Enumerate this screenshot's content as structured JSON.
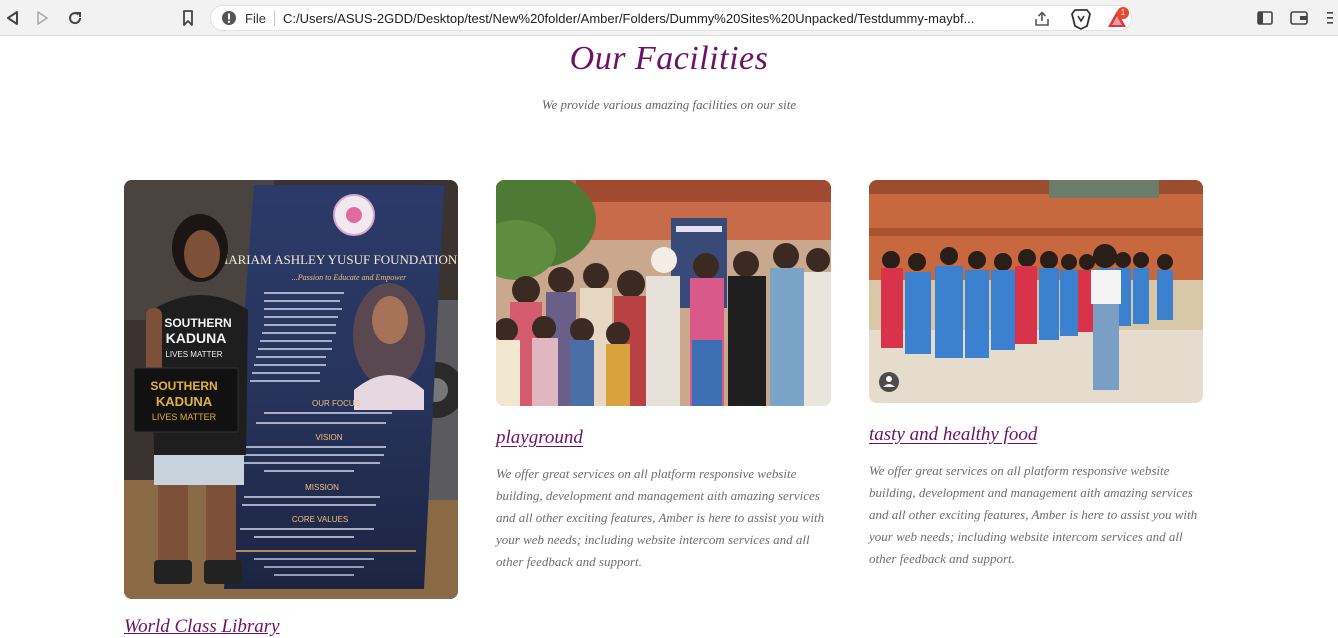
{
  "browser": {
    "file_label": "File",
    "url": "C:/Users/ASUS-2GDD/Desktop/test/New%20folder/Amber/Folders/Dummy%20Sites%20Unpacked/Testdummy-maybf...",
    "rewards_badge": "1"
  },
  "section": {
    "title": "Our Facilities",
    "subtitle": "We provide various amazing facilities on our site"
  },
  "cards": [
    {
      "title": "World Class Library",
      "image": {
        "banner_heading": "MARIAM ASHLEY YUSUF FOUNDATION",
        "banner_tagline": "...Passion to Educate and Empower",
        "banner_focus": "OUR FOCUS",
        "banner_vision": "VISION",
        "banner_mission": "MISSION",
        "banner_values": "CORE VALUES",
        "shirt_text_1": "SOUTHERN",
        "shirt_text_2": "KADUNA",
        "shirt_text_3": "LIVES MATTER"
      }
    },
    {
      "title": "playground",
      "text": "We offer great services on all platform responsive website building, development and management aith amazing services and all other exciting features, Amber is here to assist you with your web needs; including website intercom services and all other feedback and support."
    },
    {
      "title": "tasty and healthy food",
      "text": "We offer great services on all platform responsive website building, development and management aith amazing services and all other exciting features, Amber is here to assist you with your web needs; including website intercom services and all other feedback and support."
    }
  ],
  "colors": {
    "accent": "#6b1269",
    "text_muted": "#6e6e6e"
  }
}
